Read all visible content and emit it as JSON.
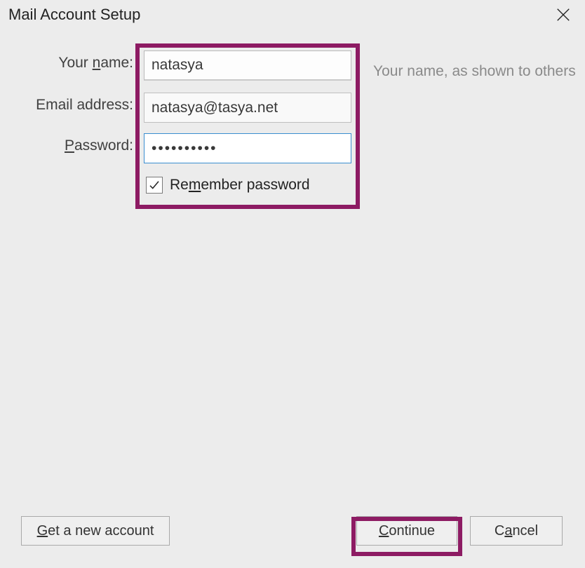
{
  "window": {
    "title": "Mail Account Setup"
  },
  "form": {
    "name": {
      "label_pre": "Your ",
      "label_u": "n",
      "label_post": "ame:",
      "value": "natasya",
      "hint": "Your name, as shown to others"
    },
    "email": {
      "label": "Email address:",
      "value": "natasya@tasya.net"
    },
    "password": {
      "label_u": "P",
      "label_post": "assword:",
      "value": "••••••••••"
    },
    "remember": {
      "label_pre": "Re",
      "label_u": "m",
      "label_post": "ember password",
      "checked": true
    }
  },
  "buttons": {
    "new_account_u": "G",
    "new_account_post": "et a new account",
    "continue_u": "C",
    "continue_post": "ontinue",
    "cancel_pre": "C",
    "cancel_u": "a",
    "cancel_post": "ncel"
  }
}
